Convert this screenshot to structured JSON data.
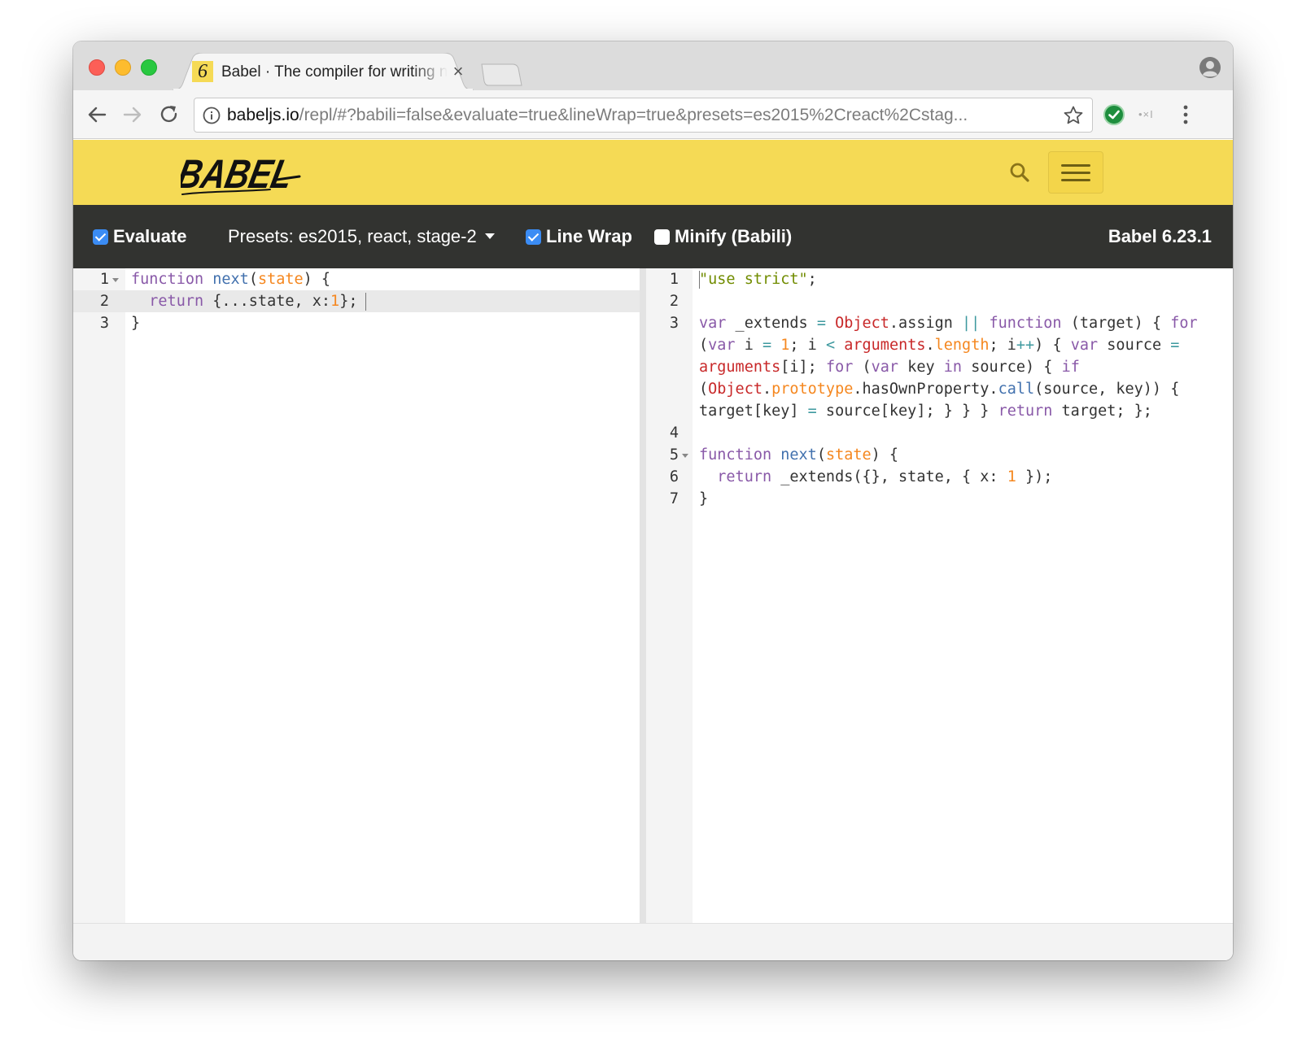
{
  "browser": {
    "tab_favicon": "6",
    "tab_title": "Babel · The compiler for writing next generation JavaScript",
    "tab_close": "×",
    "url_host": "babeljs.io",
    "url_path": "/repl/#?babili=false&evaluate=true&lineWrap=true&presets=es2015%2Creact%2Cstag...",
    "ext_label": "•×I"
  },
  "header": {
    "logo_text": "BABEL"
  },
  "options": {
    "evaluate": {
      "label": "Evaluate",
      "checked": true
    },
    "presets_label": "Presets: es2015, react, stage-2",
    "line_wrap": {
      "label": "Line Wrap",
      "checked": true
    },
    "minify": {
      "label": "Minify (Babili)",
      "checked": false
    },
    "version": "Babel 6.23.1"
  },
  "input_editor": {
    "line_numbers": [
      "1",
      "2",
      "3"
    ],
    "lines": [
      [
        [
          "k",
          "function "
        ],
        [
          "f",
          "next"
        ],
        [
          "",
          "("
        ],
        [
          "p",
          "state"
        ],
        [
          "",
          ") {"
        ]
      ],
      [
        [
          "",
          "  "
        ],
        [
          "k",
          "return"
        ],
        [
          "",
          " {...state, x:"
        ],
        [
          "n",
          "1"
        ],
        [
          "",
          "};"
        ]
      ],
      [
        [
          "",
          "}"
        ]
      ]
    ]
  },
  "output_editor": {
    "line_numbers": [
      "1",
      "2",
      "3",
      "4",
      "5",
      "6",
      "7"
    ],
    "lines": [
      [
        [
          "s",
          "\"use strict\""
        ],
        [
          "",
          ";"
        ]
      ],
      [],
      [
        [
          "k",
          "var"
        ],
        [
          "",
          " _extends "
        ],
        [
          "o",
          "="
        ],
        [
          "",
          " "
        ],
        [
          "b",
          "Object"
        ],
        [
          "",
          ".assign "
        ],
        [
          "o",
          "||"
        ],
        [
          "",
          " "
        ],
        [
          "k",
          "function"
        ],
        [
          "",
          " (target) { "
        ],
        [
          "k",
          "for"
        ],
        [
          "",
          " ("
        ],
        [
          "k",
          "var"
        ],
        [
          "",
          " i "
        ],
        [
          "o",
          "="
        ],
        [
          "",
          " "
        ],
        [
          "n",
          "1"
        ],
        [
          "",
          "; i "
        ],
        [
          "o",
          "<"
        ],
        [
          "",
          " "
        ],
        [
          "b",
          "arguments"
        ],
        [
          "",
          "."
        ],
        [
          "p",
          "length"
        ],
        [
          "",
          "; i"
        ],
        [
          "o",
          "++"
        ],
        [
          "",
          ") { "
        ],
        [
          "k",
          "var"
        ],
        [
          "",
          " source "
        ],
        [
          "o",
          "="
        ],
        [
          "",
          " "
        ],
        [
          "b",
          "arguments"
        ],
        [
          "",
          "[i]; "
        ],
        [
          "k",
          "for"
        ],
        [
          "",
          " ("
        ],
        [
          "k",
          "var"
        ],
        [
          "",
          " key "
        ],
        [
          "k",
          "in"
        ],
        [
          "",
          " source) { "
        ],
        [
          "k",
          "if"
        ],
        [
          "",
          " ("
        ],
        [
          "b",
          "Object"
        ],
        [
          "",
          "."
        ],
        [
          "p",
          "prototype"
        ],
        [
          "",
          ".hasOwnProperty."
        ],
        [
          "f",
          "call"
        ],
        [
          "",
          "(source, key)) { target[key] "
        ],
        [
          "o",
          "="
        ],
        [
          "",
          " source[key]; } } } "
        ],
        [
          "k",
          "return"
        ],
        [
          "",
          " target; };"
        ]
      ],
      [],
      [
        [
          "k",
          "function "
        ],
        [
          "f",
          "next"
        ],
        [
          "",
          "("
        ],
        [
          "p",
          "state"
        ],
        [
          "",
          ") {"
        ]
      ],
      [
        [
          "",
          "  "
        ],
        [
          "k",
          "return"
        ],
        [
          "",
          " _extends({}, state, { x: "
        ],
        [
          "n",
          "1"
        ],
        [
          "",
          " });"
        ]
      ],
      [
        [
          "",
          "}"
        ]
      ]
    ],
    "folds": [
      false,
      false,
      false,
      false,
      true,
      false,
      false
    ]
  },
  "colors": {
    "header_yellow": "#f5da55",
    "options_bar": "#323330",
    "checkbox_blue": "#3b8cf4",
    "keyword": "#8959a8",
    "function_name": "#4271ae",
    "param_number": "#f5871f",
    "string": "#718c00",
    "builtin": "#c82829",
    "operator": "#3e999f"
  },
  "icons": {
    "back": "arrow-left-icon",
    "forward": "arrow-right-icon",
    "reload": "reload-icon",
    "info": "info-icon",
    "star": "star-icon",
    "extension": "shield-check-icon",
    "menu": "vertical-dots-icon",
    "profile": "profile-icon",
    "search": "search-icon",
    "hamburger": "hamburger-menu-icon"
  }
}
